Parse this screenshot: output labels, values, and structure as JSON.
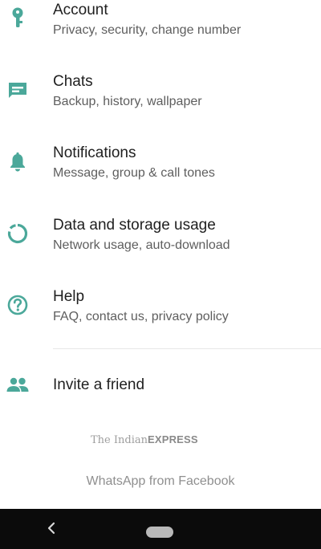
{
  "settings": {
    "items": [
      {
        "title": "Account",
        "subtitle": "Privacy, security, change number",
        "icon": "key-icon"
      },
      {
        "title": "Chats",
        "subtitle": "Backup, history, wallpaper",
        "icon": "chat-icon"
      },
      {
        "title": "Notifications",
        "subtitle": "Message, group & call tones",
        "icon": "bell-icon"
      },
      {
        "title": "Data and storage usage",
        "subtitle": "Network usage, auto-download",
        "icon": "data-usage-icon"
      },
      {
        "title": "Help",
        "subtitle": "FAQ, contact us, privacy policy",
        "icon": "help-icon"
      }
    ],
    "invite": {
      "title": "Invite a friend",
      "icon": "people-icon"
    }
  },
  "watermark": {
    "prefix": "The Indian",
    "brand": "EXPRESS"
  },
  "footer": {
    "text": "WhatsApp from Facebook"
  },
  "nav_bar": {
    "back_icon": "back-chevron-icon",
    "home_icon": "home-pill-icon"
  },
  "colors": {
    "icon_accent": "#4ba89a",
    "title_text": "#1f1f1f",
    "subtitle_text": "#5e5e5e",
    "footer_text": "#8f8f8f",
    "nav_bar_bg": "#0b0b0b"
  }
}
